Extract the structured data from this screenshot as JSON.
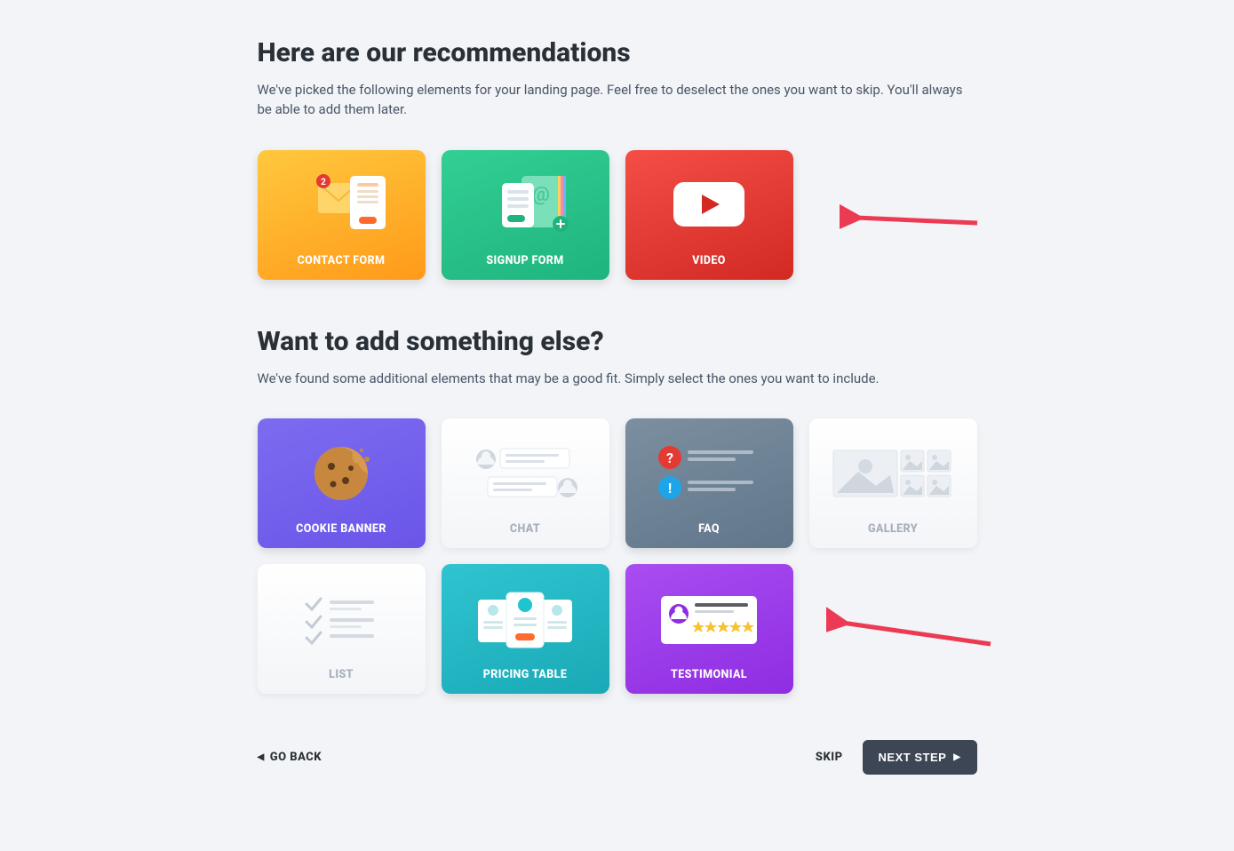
{
  "sections": {
    "recommendations": {
      "title": "Here are our recommendations",
      "description": "We've picked the following elements for your landing page. Feel free to deselect the ones you want to skip. You'll always be able to add them later."
    },
    "additional": {
      "title": "Want to add something else?",
      "description": "We've found some additional elements that may be a good fit. Simply select the ones you want to include."
    }
  },
  "cards": {
    "contact_form": "CONTACT FORM",
    "signup_form": "SIGNUP FORM",
    "video": "VIDEO",
    "cookie_banner": "COOKIE BANNER",
    "chat": "CHAT",
    "faq": "FAQ",
    "gallery": "GALLERY",
    "list": "LIST",
    "pricing_table": "PRICING TABLE",
    "testimonial": "TESTIMONIAL"
  },
  "buttons": {
    "go_back": "GO BACK",
    "skip": "SKIP",
    "next": "NEXT STEP"
  }
}
